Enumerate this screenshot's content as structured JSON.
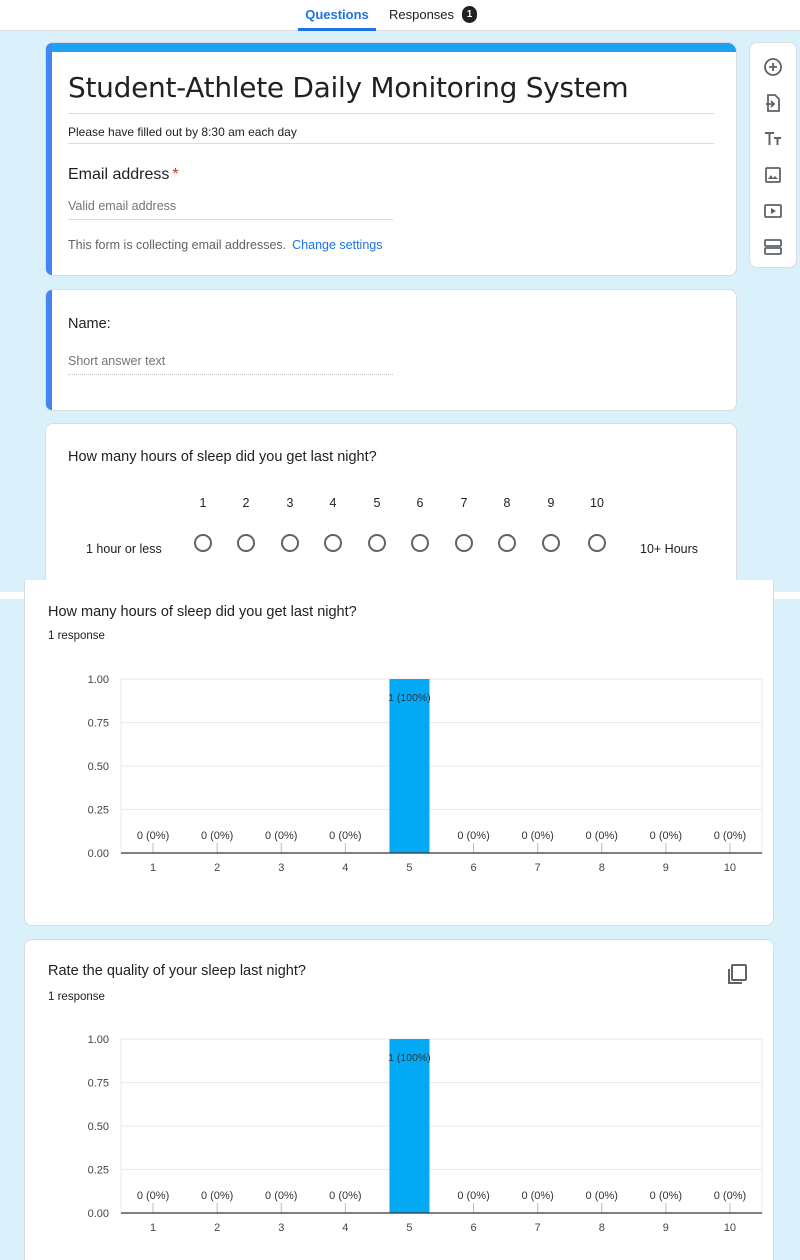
{
  "tabs": {
    "questions_label": "Questions",
    "responses_label": "Responses",
    "responses_count": "1"
  },
  "header": {
    "title": "Student-Athlete Daily Monitoring System",
    "description": "Please have filled out by 8:30 am each day",
    "email_label": "Email address",
    "required_mark": "*",
    "email_placeholder": "Valid email address",
    "collecting_note": "This form is collecting email addresses.",
    "change_settings_link": "Change settings"
  },
  "toolbar": {
    "icons": [
      "add-question-icon",
      "import-questions-icon",
      "add-title-icon",
      "add-image-icon",
      "add-video-icon",
      "add-section-icon"
    ]
  },
  "questions": [
    {
      "label": "Name:",
      "placeholder": "Short answer text"
    },
    {
      "label": "How many hours of sleep did you get last night?",
      "scale": [
        "1",
        "2",
        "3",
        "4",
        "5",
        "6",
        "7",
        "8",
        "9",
        "10"
      ],
      "low_label": "1 hour or less",
      "high_label": "10+ Hours"
    }
  ],
  "responses": [
    {
      "title": "How many hours of sleep did you get last night?",
      "count_label": "1 response"
    },
    {
      "title": "Rate the quality of your sleep last night?",
      "count_label": "1 response"
    }
  ],
  "colors": {
    "accent": "#1a73e8",
    "bar": "#03a9f4",
    "background": "#daf0fb",
    "section_bar": "#4285f4"
  },
  "chart_data": [
    {
      "type": "bar",
      "categories": [
        "1",
        "2",
        "3",
        "4",
        "5",
        "6",
        "7",
        "8",
        "9",
        "10"
      ],
      "values": [
        0,
        0,
        0,
        0,
        1,
        0,
        0,
        0,
        0,
        0
      ],
      "data_labels": [
        "0 (0%)",
        "0 (0%)",
        "0 (0%)",
        "0 (0%)",
        "1 (100%)",
        "0 (0%)",
        "0 (0%)",
        "0 (0%)",
        "0 (0%)",
        "0 (0%)"
      ],
      "yticks": [
        "0.00",
        "0.25",
        "0.50",
        "0.75",
        "1.00"
      ],
      "ylim": [
        0,
        1
      ],
      "grid": true,
      "legend": "none"
    },
    {
      "type": "bar",
      "categories": [
        "1",
        "2",
        "3",
        "4",
        "5",
        "6",
        "7",
        "8",
        "9",
        "10"
      ],
      "values": [
        0,
        0,
        0,
        0,
        1,
        0,
        0,
        0,
        0,
        0
      ],
      "data_labels": [
        "0 (0%)",
        "0 (0%)",
        "0 (0%)",
        "0 (0%)",
        "1 (100%)",
        "0 (0%)",
        "0 (0%)",
        "0 (0%)",
        "0 (0%)",
        "0 (0%)"
      ],
      "yticks": [
        "0.00",
        "0.25",
        "0.50",
        "0.75",
        "1.00"
      ],
      "ylim": [
        0,
        1
      ],
      "grid": true,
      "legend": "none"
    }
  ]
}
